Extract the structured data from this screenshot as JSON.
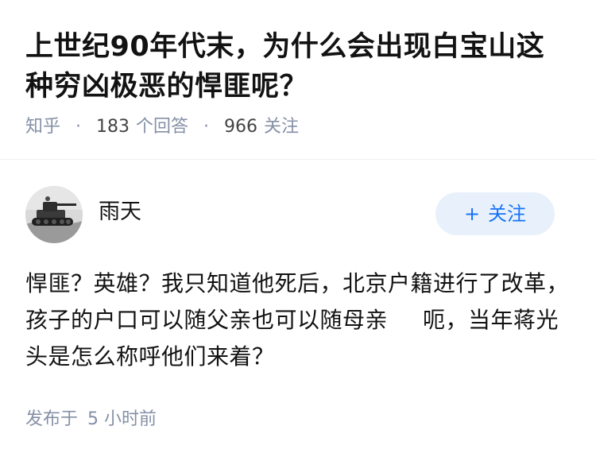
{
  "question": {
    "title": "上世纪90年代末，为什么会出现白宝山这种穷凶极恶的悍匪呢？",
    "source": "知乎",
    "answer_count": "183",
    "answer_count_label": "个回答",
    "follow_count": "966",
    "follow_count_label": "关注"
  },
  "answer": {
    "author_name": "雨天",
    "follow_button_label": "关注",
    "follow_button_icon": "plus-icon",
    "avatar_icon": "tank-photo-avatar",
    "body_line_1": "悍匪？英雄？我只知道他死后，北京户籍进行了改革，孩子的户口可以随父亲也可以随母亲",
    "body_line_2": "呃，当年蒋光头是怎么称呼他们来着？",
    "published_label": "发布于",
    "published_time": "5 小时前"
  },
  "colors": {
    "text_primary": "#121212",
    "text_secondary": "#8590a6",
    "accent_blue": "#1772f6",
    "follow_bg": "#e8f1fb"
  }
}
